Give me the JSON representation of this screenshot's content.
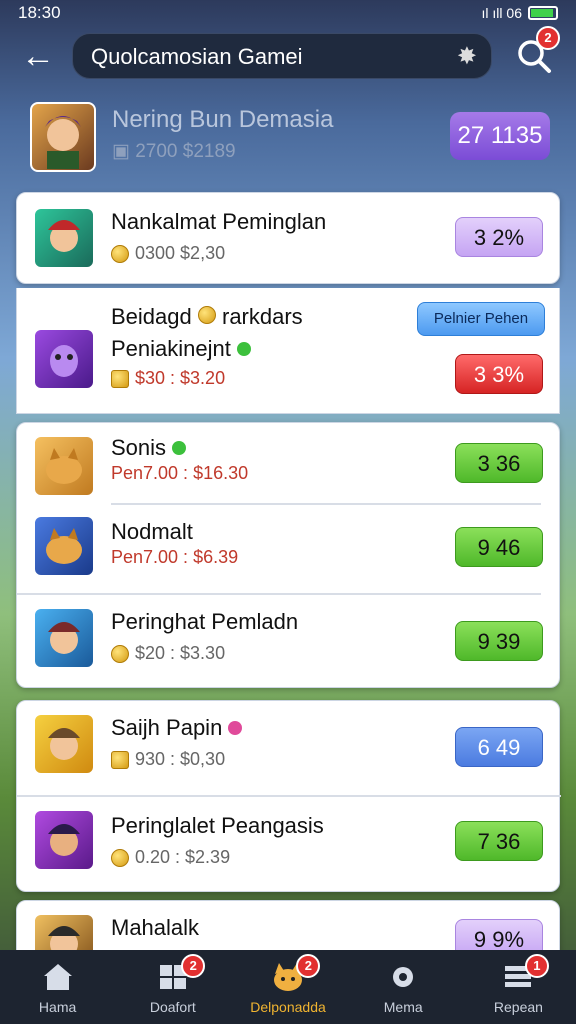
{
  "status": {
    "time": "18:30",
    "icons": "ıl ıll 06"
  },
  "header": {
    "search_value": "Quolcamosian Gamei",
    "notify_count": "2"
  },
  "hero": {
    "name": "Nering Bun Demasia",
    "price": "2700 $2189",
    "pill": "27 1135"
  },
  "items": [
    {
      "title": "Nankalmat Peminglan",
      "sub": "0300 $2,30",
      "pill": "3 2%"
    },
    {
      "title": "Beidagd",
      "title_b": "rarkdars",
      "title2": "Peniakinejnt",
      "sub": "$30 : $3.20",
      "pill": "3 3%",
      "tag": "Pelnier Pehen"
    },
    {
      "title": "Sonis",
      "sub": "Pen7.00 : $16.30",
      "pill": "3 36"
    },
    {
      "title": "Nodmalt",
      "sub": "Pen7.00 : $6.39",
      "pill": "9 46"
    },
    {
      "title": "Peringhat Pemladn",
      "sub": "$20 : $3.30",
      "pill": "9 39"
    },
    {
      "title": "Saijh Papin",
      "sub": "930 : $0,30",
      "pill": "6 49"
    },
    {
      "title": "Peringlalet Peangasis",
      "sub": "0.20 : $2.39",
      "pill": "7 36"
    },
    {
      "title": "Mahalalk",
      "sub": "",
      "pill": "9 9%"
    }
  ],
  "nav": [
    {
      "label": "Hama",
      "badge": ""
    },
    {
      "label": "Doafort",
      "badge": "2"
    },
    {
      "label": "Delponadda",
      "badge": "2"
    },
    {
      "label": "Mema",
      "badge": ""
    },
    {
      "label": "Repean",
      "badge": "1"
    }
  ]
}
